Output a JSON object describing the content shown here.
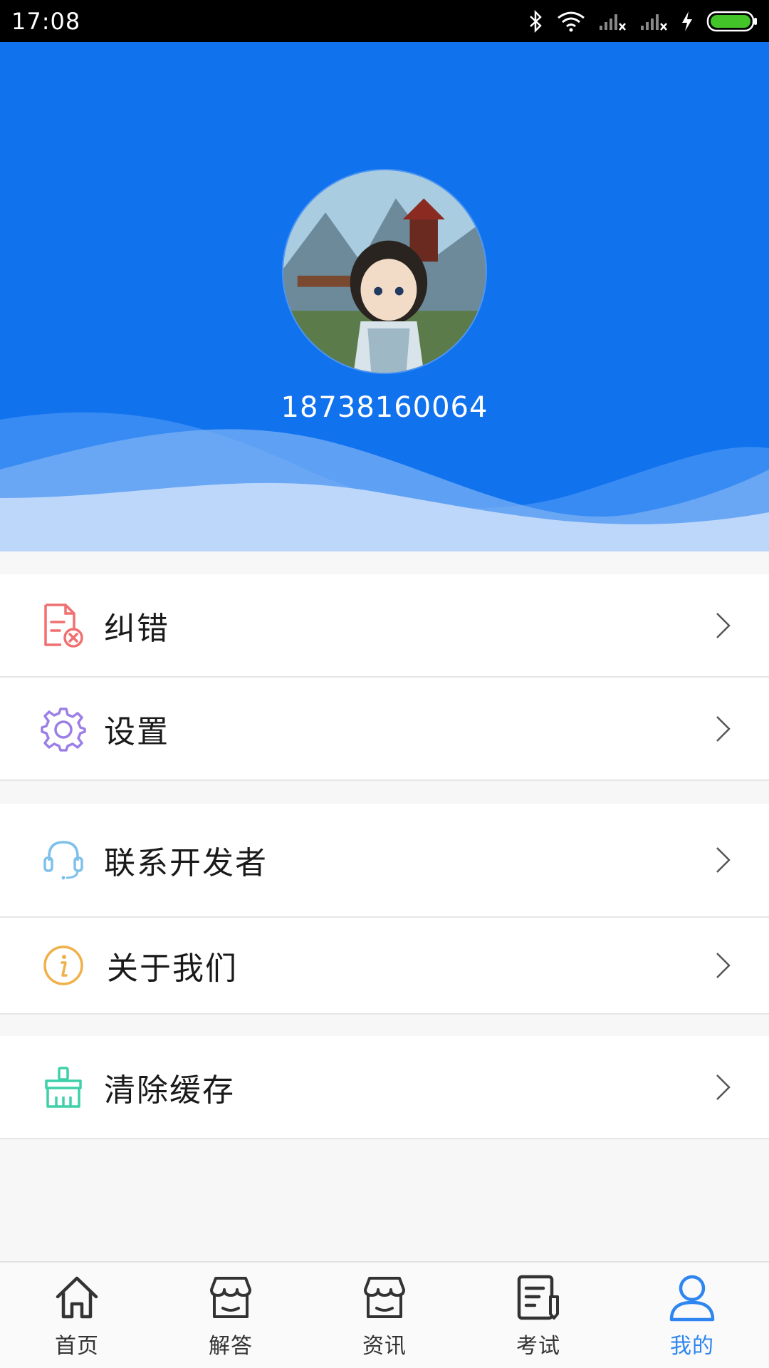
{
  "status_bar": {
    "time": "17:08"
  },
  "profile": {
    "username": "18738160064"
  },
  "menu_groups": [
    {
      "items": [
        {
          "label": "纠错",
          "icon": "error-report-icon",
          "color": "#f07070"
        },
        {
          "label": "设置",
          "icon": "gear-icon",
          "color": "#9b7fe6"
        }
      ]
    },
    {
      "items": [
        {
          "label": "联系开发者",
          "icon": "headset-icon",
          "color": "#7ec0ec"
        },
        {
          "label": "关于我们",
          "icon": "info-icon",
          "color": "#f0b04a"
        }
      ]
    },
    {
      "items": [
        {
          "label": "清除缓存",
          "icon": "broom-icon",
          "color": "#3ed0a8"
        }
      ]
    }
  ],
  "bottom_nav": {
    "items": [
      {
        "label": "首页",
        "icon": "home-icon"
      },
      {
        "label": "解答",
        "icon": "shop-icon"
      },
      {
        "label": "资讯",
        "icon": "shop-icon"
      },
      {
        "label": "考试",
        "icon": "exam-icon"
      },
      {
        "label": "我的",
        "icon": "user-icon"
      }
    ],
    "active_index": 4,
    "active_color": "#2f86f0"
  },
  "colors": {
    "header": "#1172ee",
    "background": "#f7f7f7"
  }
}
